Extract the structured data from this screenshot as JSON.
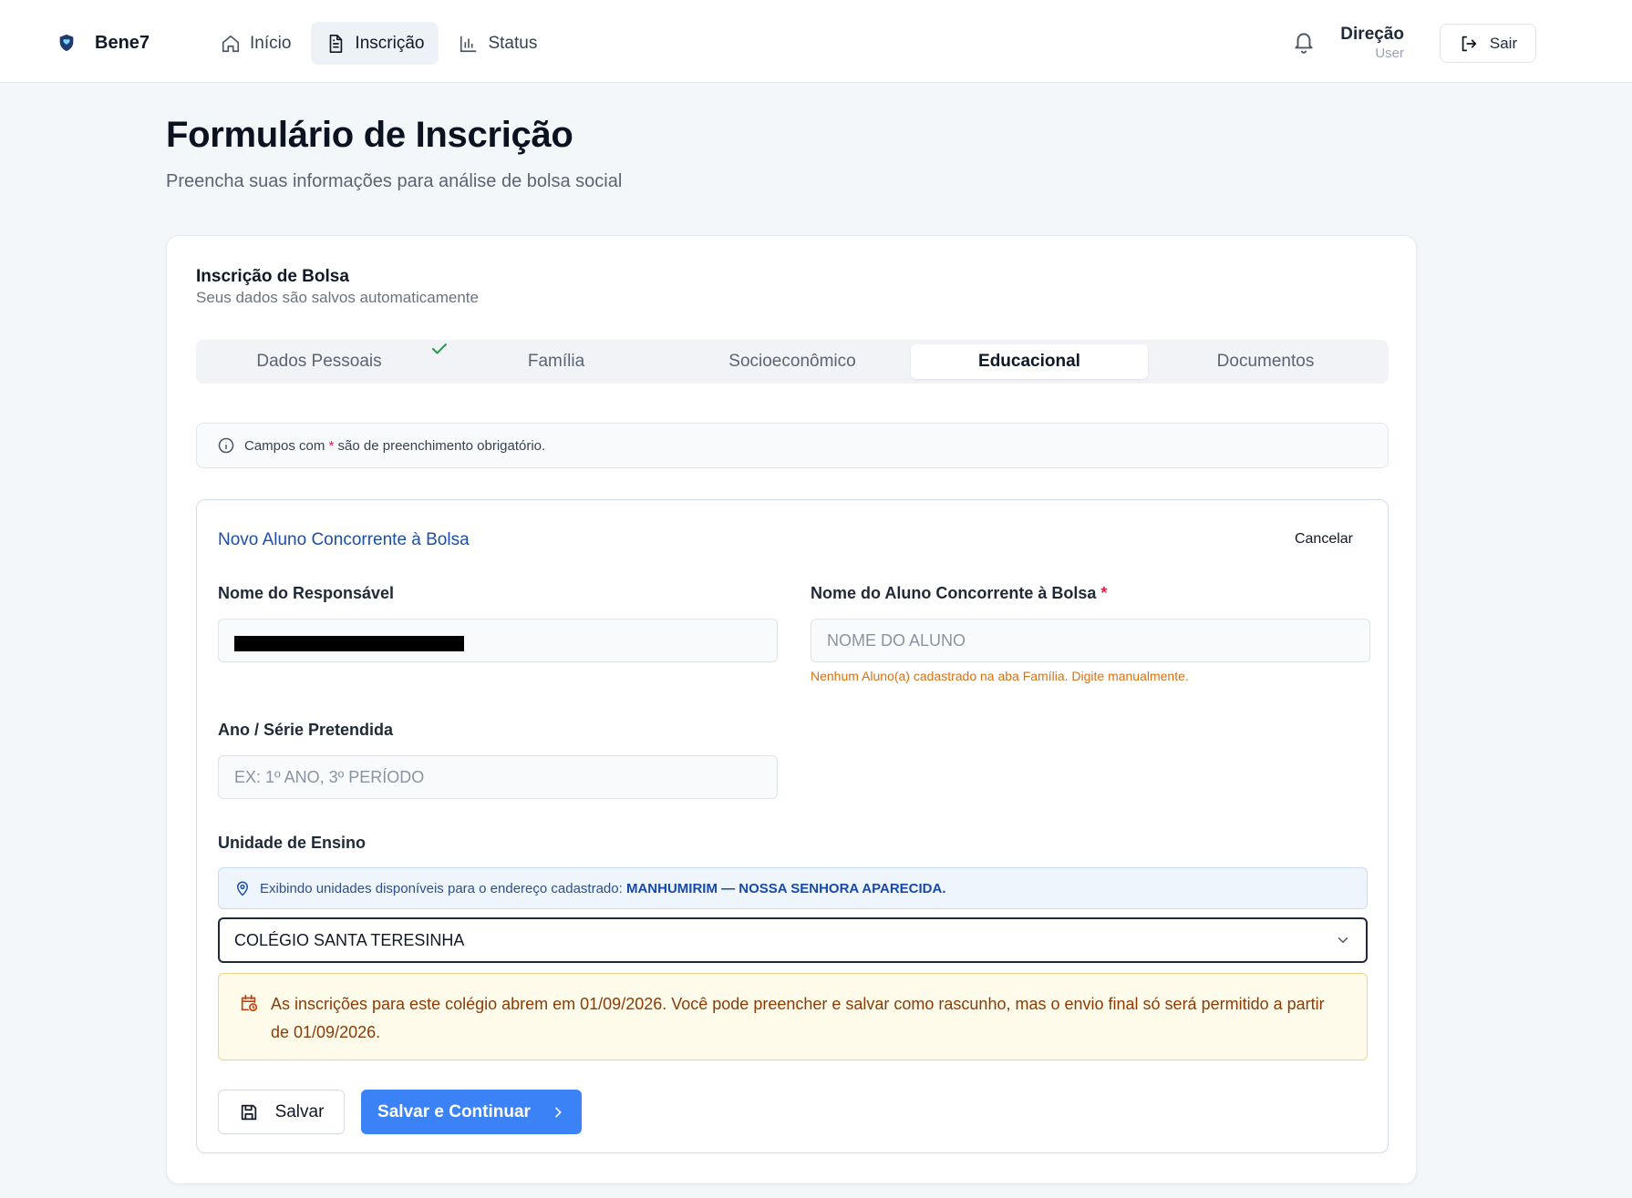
{
  "colors": {
    "primary": "#3b82f6",
    "form_title": "#1d4ea8",
    "warning_text": "#8a3b06",
    "hint_text": "#d9700f",
    "required": "#e11d48",
    "success": "#16a34a"
  },
  "topbar": {
    "brand_icon": "shield-icon",
    "brand_name": "Bene7",
    "nav": [
      {
        "label": "Início",
        "icon": "home-icon"
      },
      {
        "label": "Inscrição",
        "icon": "document-icon",
        "active": true
      },
      {
        "label": "Status",
        "icon": "bar-chart-icon"
      }
    ],
    "notifications_icon": "bell-icon",
    "user": {
      "name": "Direção",
      "role": "User"
    },
    "logout_label": "Sair",
    "logout_icon": "logout-icon"
  },
  "page": {
    "title": "Formulário de Inscrição",
    "subtitle": "Preencha suas informações para análise de bolsa social"
  },
  "card": {
    "title": "Inscrição de Bolsa",
    "subtitle": "Seus dados são salvos automaticamente",
    "tabs": [
      {
        "label": "Dados Pessoais",
        "completed": true
      },
      {
        "label": "Família"
      },
      {
        "label": "Socioeconômico"
      },
      {
        "label": "Educacional",
        "active": true
      },
      {
        "label": "Documentos"
      }
    ],
    "notice": {
      "before": "Campos com",
      "asterisk": "*",
      "after": "são de preenchimento obrigatório."
    }
  },
  "form": {
    "title": "Novo Aluno Concorrente à Bolsa",
    "cancel_label": "Cancelar",
    "responsavel_label": "Nome do Responsável",
    "aluno_label": "Nome do Aluno Concorrente à Bolsa",
    "aluno_required": "*",
    "aluno_placeholder": "NOME DO ALUNO",
    "aluno_hint": "Nenhum Aluno(a) cadastrado na aba Família. Digite manualmente.",
    "serie_label": "Ano / Série Pretendida",
    "serie_placeholder": "EX: 1º ANO, 3º PERÍODO",
    "unidade_label": "Unidade de Ensino",
    "geo_text": "Exibindo unidades disponíveis para o endereço cadastrado:",
    "geo_location": "MANHUMIRIM — NOSSA SENHORA APARECIDA.",
    "unidade_selected": "COLÉGIO SANTA TERESINHA",
    "warning_text": "As inscrições para este colégio abrem em 01/09/2026. Você pode preencher e salvar como rascunho, mas o envio final só será permitido a partir de 01/09/2026.",
    "save_label": "Salvar",
    "continue_label": "Salvar e Continuar"
  }
}
